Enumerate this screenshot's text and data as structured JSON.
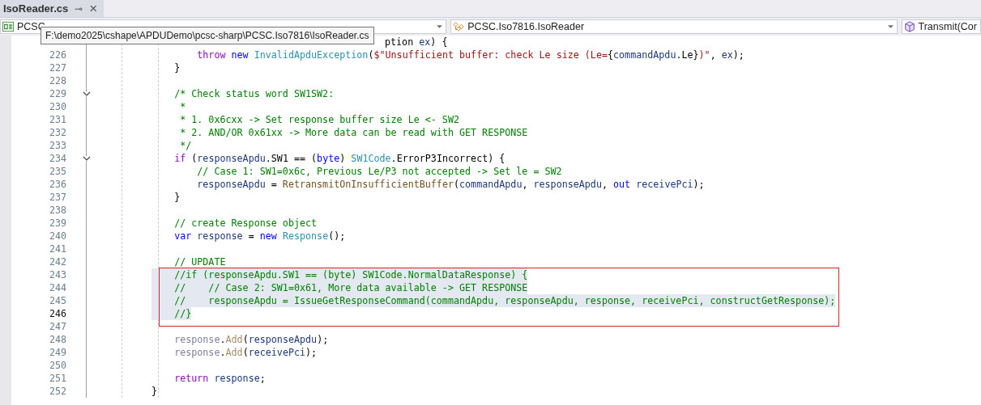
{
  "tab": {
    "title": "IsoReader.cs",
    "pin": "⊸",
    "close": "×",
    "selected": true
  },
  "nav": [
    {
      "kind": "project",
      "text": "PCSC"
    },
    {
      "kind": "class",
      "text": "PCSC.Iso7816.IsoReader"
    },
    {
      "kind": "member",
      "text": "Transmit(Cor"
    }
  ],
  "tooltip": "F:\\demo2025\\cshape\\APDUDemo\\pcsc-sharp\\PCSC.Iso7816\\IsoReader.cs",
  "lines": [
    {
      "covered": true,
      "tokens": [
        {
          "kind": "p",
          "text": "ption "
        },
        {
          "kind": "id",
          "text": "ex"
        },
        {
          "kind": "p",
          "text": ") {"
        }
      ]
    },
    {
      "num": "226",
      "tokens": [
        {
          "kind": "ctl",
          "text": "        throw"
        },
        {
          "kind": "kw",
          "text": " new"
        },
        {
          "kind": "type",
          "text": " InvalidApduException"
        },
        {
          "kind": "p",
          "text": "("
        },
        {
          "kind": "str",
          "text": "$\"Unsufficient buffer: check Le size (Le="
        },
        {
          "kind": "p",
          "text": "{"
        },
        {
          "kind": "id",
          "text": "commandApdu"
        },
        {
          "kind": "p",
          "text": ".Le}"
        },
        {
          "kind": "str",
          "text": ")\""
        },
        {
          "kind": "p",
          "text": ", "
        },
        {
          "kind": "id",
          "text": "ex"
        },
        {
          "kind": "p",
          "text": ");"
        }
      ]
    },
    {
      "num": "227",
      "tokens": [
        {
          "kind": "p",
          "text": "    }"
        }
      ]
    },
    {
      "num": "228"
    },
    {
      "num": "229",
      "fold": true,
      "tokens": [
        {
          "kind": "cm",
          "text": "    /* Check status word SW1SW2:"
        }
      ]
    },
    {
      "num": "230",
      "tokens": [
        {
          "kind": "cm",
          "text": "     *"
        }
      ]
    },
    {
      "num": "231",
      "tokens": [
        {
          "kind": "cm",
          "text": "     * 1. 0x6cxx -> Set response buffer size Le <- SW2"
        }
      ]
    },
    {
      "num": "232",
      "tokens": [
        {
          "kind": "cm",
          "text": "     * 2. AND/OR 0x61xx -> More data can be read with GET RESPONSE"
        }
      ]
    },
    {
      "num": "233",
      "tokens": [
        {
          "kind": "cm",
          "text": "     */"
        }
      ]
    },
    {
      "num": "234",
      "fold": true,
      "tokens": [
        {
          "kind": "ctl",
          "text": "    if"
        },
        {
          "kind": "p",
          "text": " ("
        },
        {
          "kind": "id",
          "text": "responseApdu"
        },
        {
          "kind": "p",
          "text": ".SW1 == ("
        },
        {
          "kind": "kw",
          "text": "byte"
        },
        {
          "kind": "p",
          "text": ") "
        },
        {
          "kind": "type",
          "text": "SW1Code"
        },
        {
          "kind": "p",
          "text": ".ErrorP3Incorrect) {"
        }
      ]
    },
    {
      "num": "235",
      "tokens": [
        {
          "kind": "cm",
          "text": "        // Case 1: SW1=0x6c, Previous Le/P3 not accepted -> Set le = SW2"
        }
      ]
    },
    {
      "num": "236",
      "tokens": [
        {
          "kind": "id",
          "text": "        responseApdu"
        },
        {
          "kind": "p",
          "text": " = "
        },
        {
          "kind": "mth",
          "text": "RetransmitOnInsufficientBuffer"
        },
        {
          "kind": "p",
          "text": "("
        },
        {
          "kind": "id",
          "text": "commandApdu"
        },
        {
          "kind": "p",
          "text": ", "
        },
        {
          "kind": "id",
          "text": "responseApdu"
        },
        {
          "kind": "p",
          "text": ", "
        },
        {
          "kind": "kw",
          "text": "out"
        },
        {
          "kind": "id",
          "text": " receivePci"
        },
        {
          "kind": "p",
          "text": ");"
        }
      ]
    },
    {
      "num": "237",
      "tokens": [
        {
          "kind": "p",
          "text": "    }"
        }
      ]
    },
    {
      "num": "238"
    },
    {
      "num": "239",
      "tokens": [
        {
          "kind": "cm",
          "text": "    // create Response object"
        }
      ]
    },
    {
      "num": "240",
      "tokens": [
        {
          "kind": "kw",
          "text": "    var"
        },
        {
          "kind": "id",
          "text": " response"
        },
        {
          "kind": "p",
          "text": " = "
        },
        {
          "kind": "kw",
          "text": "new"
        },
        {
          "kind": "type",
          "text": " Response"
        },
        {
          "kind": "p",
          "text": "();"
        }
      ]
    },
    {
      "num": "241"
    },
    {
      "num": "242",
      "tokens": [
        {
          "kind": "cm",
          "text": "    // UPDATE"
        }
      ]
    },
    {
      "num": "243",
      "selected": true,
      "boxed": true,
      "tokens": [
        {
          "kind": "cm",
          "text": "    //if (responseApdu.SW1 == (byte) SW1Code.NormalDataResponse) {"
        }
      ]
    },
    {
      "num": "244",
      "selected": true,
      "boxed": true,
      "tokens": [
        {
          "kind": "cm",
          "text": "    //    // Case 2: SW1=0x61, More data available -> GET RESPONSE"
        }
      ]
    },
    {
      "num": "245",
      "selected": true,
      "boxed": true,
      "tokens": [
        {
          "kind": "cm",
          "text": "    //    responseApdu = IssueGetResponseCommand(commandApdu, responseApdu, response, receivePci, constructGetResponse);"
        }
      ]
    },
    {
      "num": "246",
      "selected": true,
      "boxed": true,
      "current": true,
      "tokens": [
        {
          "kind": "cm",
          "text": "    //}"
        }
      ]
    },
    {
      "num": "247"
    },
    {
      "num": "248",
      "tokens": [
        {
          "kind": "dim",
          "text": "    response"
        },
        {
          "kind": "p",
          "text": "."
        },
        {
          "kind": "dimm",
          "text": "Add"
        },
        {
          "kind": "p",
          "text": "("
        },
        {
          "kind": "id",
          "text": "responseApdu"
        },
        {
          "kind": "p",
          "text": ");"
        }
      ]
    },
    {
      "num": "249",
      "tokens": [
        {
          "kind": "dim",
          "text": "    response"
        },
        {
          "kind": "p",
          "text": "."
        },
        {
          "kind": "dimm",
          "text": "Add"
        },
        {
          "kind": "p",
          "text": "("
        },
        {
          "kind": "id",
          "text": "receivePci"
        },
        {
          "kind": "p",
          "text": ");"
        }
      ]
    },
    {
      "num": "250"
    },
    {
      "num": "251",
      "tokens": [
        {
          "kind": "ctl",
          "text": "    return"
        },
        {
          "kind": "id",
          "text": " response"
        },
        {
          "kind": "p",
          "text": ";"
        }
      ]
    },
    {
      "num": "252",
      "tokens": [
        {
          "kind": "p",
          "text": "}"
        }
      ]
    }
  ]
}
